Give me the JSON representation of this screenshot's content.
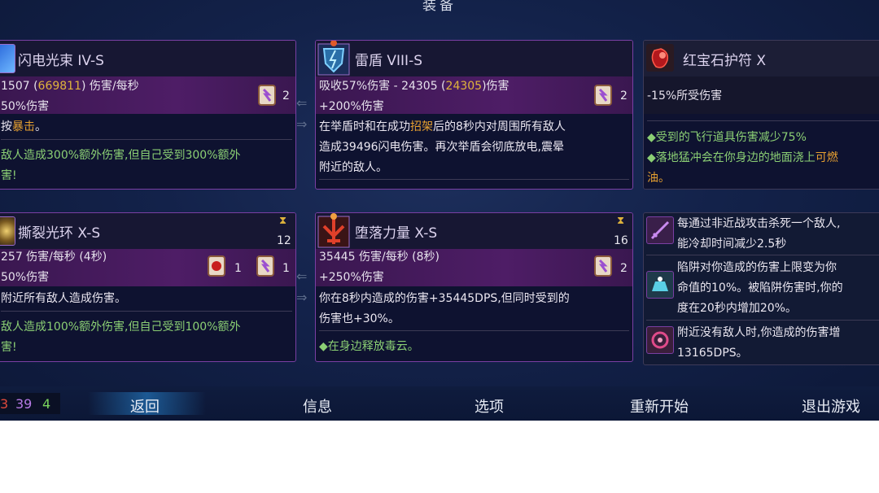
{
  "screen_title": "装备",
  "cards": {
    "lightning_beam": {
      "name": "闪电光束 IV-S",
      "line1_a": "1507 (",
      "line1_b": "669811",
      "line1_c": ") 伤害/每秒",
      "line2": "50%伤害",
      "line3_a": "按",
      "line3_b": "暴击",
      "line3_c": "。",
      "green1": "敌人造成300%额外伤害,但自己受到300%额外",
      "green2": "害!",
      "scroll_count": "2"
    },
    "thunder_shield": {
      "name": "雷盾 VIII-S",
      "line1_a": "吸收57%伤害 - 24305 (",
      "line1_b": "24305",
      "line1_c": ")伤害",
      "line2": "+200%伤害",
      "desc1_a": "在举盾时和在成功",
      "desc1_b": "招架",
      "desc1_c": "后的8秒内对周围所有敌人",
      "desc2": "造成39496闪电伤害。再次举盾会彻底放电,震晕",
      "desc3": "附近的敌人。",
      "scroll_count": "2"
    },
    "ruby_amulet": {
      "name": "红宝石护符 X",
      "line1": "-15%所受伤害",
      "green1": "◆受到的飞行道具伤害减少75%",
      "green2_a": "◆落地猛冲会在你身边的地面浇上",
      "green2_b": "可燃",
      "green3": "油。"
    },
    "tearing_halo": {
      "name": "撕裂光环 X-S",
      "cooldown": "12",
      "line1": "257 伤害/每秒 (4秒)",
      "line2": "50%伤害",
      "desc1": "附近所有敌人造成伤害。",
      "green1": "敌人造成100%额外伤害,但自己受到100%额外",
      "green2": "害!",
      "count_a": "1",
      "count_b": "1"
    },
    "fallen_power": {
      "name": "堕落力量 X-S",
      "cooldown": "16",
      "line1": "35445 伤害/每秒 (8秒)",
      "line2": "+250%伤害",
      "desc1": "你在8秒内造成的伤害+35445DPS,但同时受到的",
      "desc2": "伤害也+30%。",
      "green1": "◆在身边释放毒云。",
      "scroll_count": "2"
    }
  },
  "mutations": [
    {
      "line1": "每通过非近战攻击杀死一个敌人,",
      "line2": "能冷却时间减少2.5秒"
    },
    {
      "line1": "陷阱对你造成的伤害上限变为你",
      "line2": "命值的10%。被陷阱伤害时,你的",
      "line3": "度在20秒内增加20%。"
    },
    {
      "line1": "附近没有敌人时,你造成的伤害增",
      "line2": "13165DPS。"
    }
  ],
  "bottom": {
    "stat_red": "3",
    "stat_purple": "39",
    "stat_green": "4",
    "back": "返回",
    "info": "信息",
    "options": "选项",
    "restart": "重新开始",
    "quit": "退出游戏"
  },
  "colors": {
    "red": "#e04a3c",
    "purple": "#b77ae6",
    "green": "#79d35c",
    "gold": "#e0b43c",
    "highlight_green": "#8bcf74"
  }
}
